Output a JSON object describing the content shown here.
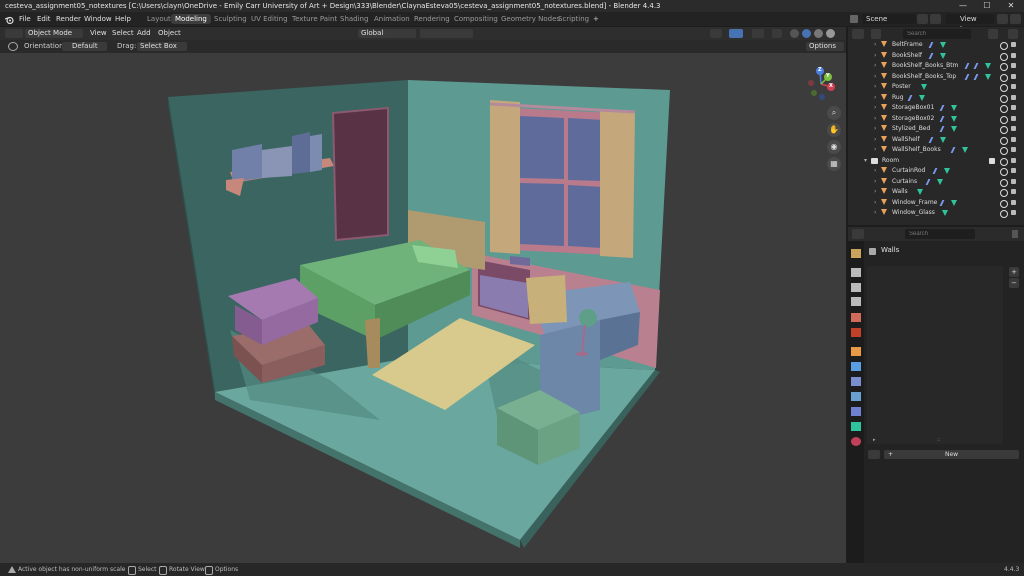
{
  "window": {
    "title": "cesteva_assignment05_notextures [C:\\Users\\clayn\\OneDrive - Emily Carr University of Art + Design\\333\\Blender\\ClaynaEsteva05\\cesteva_assignment05_notextures.blend] - Blender 4.4.3",
    "minimize": "—",
    "maximize": "☐",
    "close": "✕"
  },
  "menu": [
    "File",
    "Edit",
    "Render",
    "Window",
    "Help"
  ],
  "workspaces": [
    {
      "label": "Layout"
    },
    {
      "label": "Modeling",
      "active": true
    },
    {
      "label": "Sculpting"
    },
    {
      "label": "UV Editing"
    },
    {
      "label": "Texture Paint"
    },
    {
      "label": "Shading"
    },
    {
      "label": "Animation"
    },
    {
      "label": "Rendering"
    },
    {
      "label": "Compositing"
    },
    {
      "label": "Geometry Nodes"
    },
    {
      "label": "Scripting"
    }
  ],
  "add_workspace": "+",
  "scene": {
    "label": "Scene",
    "view_layer": "View Layer"
  },
  "viewport_header": {
    "mode": "Object Mode",
    "menus": [
      "View",
      "Select",
      "Add",
      "Object"
    ],
    "transform": "Global",
    "options": "Options",
    "orientation_label": "Orientation:",
    "orientation_value": "Default",
    "drag_label": "Drag:",
    "drag_value": "Select Box"
  },
  "gizmo": {
    "x": "X",
    "y": "Y",
    "z": "Z"
  },
  "outliner": {
    "search_placeholder": "Search",
    "items": [
      {
        "label": "BeltFrame",
        "indent": 1,
        "mods": 1,
        "mesh": 1
      },
      {
        "label": "BookShelf",
        "indent": 1,
        "mods": 1,
        "mesh": 1
      },
      {
        "label": "BookShelf_Books_Btm",
        "indent": 1,
        "mods": 2,
        "mesh": 1
      },
      {
        "label": "BookShelf_Books_Top",
        "indent": 1,
        "mods": 2,
        "mesh": 1
      },
      {
        "label": "Poster",
        "indent": 1,
        "mods": 0,
        "mesh": 1
      },
      {
        "label": "Rug",
        "indent": 1,
        "mods": 1,
        "mesh": 1
      },
      {
        "label": "StorageBox01",
        "indent": 1,
        "mods": 1,
        "mesh": 1
      },
      {
        "label": "StorageBox02",
        "indent": 1,
        "mods": 1,
        "mesh": 1
      },
      {
        "label": "Stylized_Bed",
        "indent": 1,
        "mods": 1,
        "mesh": 1
      },
      {
        "label": "WallShelf",
        "indent": 1,
        "mods": 1,
        "mesh": 1
      },
      {
        "label": "WallShelf_Books",
        "indent": 1,
        "mods": 1,
        "mesh": 1
      },
      {
        "label": "Room",
        "indent": 0,
        "collection": true
      },
      {
        "label": "CurtainRod",
        "indent": 1,
        "mods": 1,
        "mesh": 1
      },
      {
        "label": "Curtains",
        "indent": 1,
        "mods": 1,
        "mesh": 1
      },
      {
        "label": "Walls",
        "indent": 1,
        "mods": 0,
        "mesh": 1
      },
      {
        "label": "Window_Frame",
        "indent": 1,
        "mods": 1,
        "mesh": 1
      },
      {
        "label": "Window_Glass",
        "indent": 1,
        "mods": 0,
        "mesh": 1
      }
    ]
  },
  "properties": {
    "search_placeholder": "Search",
    "object_name": "Walls",
    "new_button": "New",
    "plus": "+",
    "minus": "−",
    "ellipsis": "::"
  },
  "status": {
    "warning": "Active object has non-uniform scale",
    "select": "Select",
    "rotate": "Rotate View",
    "options": "Options",
    "version": "4.4.3"
  },
  "colors": {
    "accent": "#4772b3",
    "wall": "#5d9a92",
    "wall_dark": "#3b6560",
    "floor": "#6aa89f",
    "bed_sheet": "#6fb37a",
    "wood": "#b09a70",
    "purple": "#8a62a0",
    "desk": "#6d87a9"
  }
}
